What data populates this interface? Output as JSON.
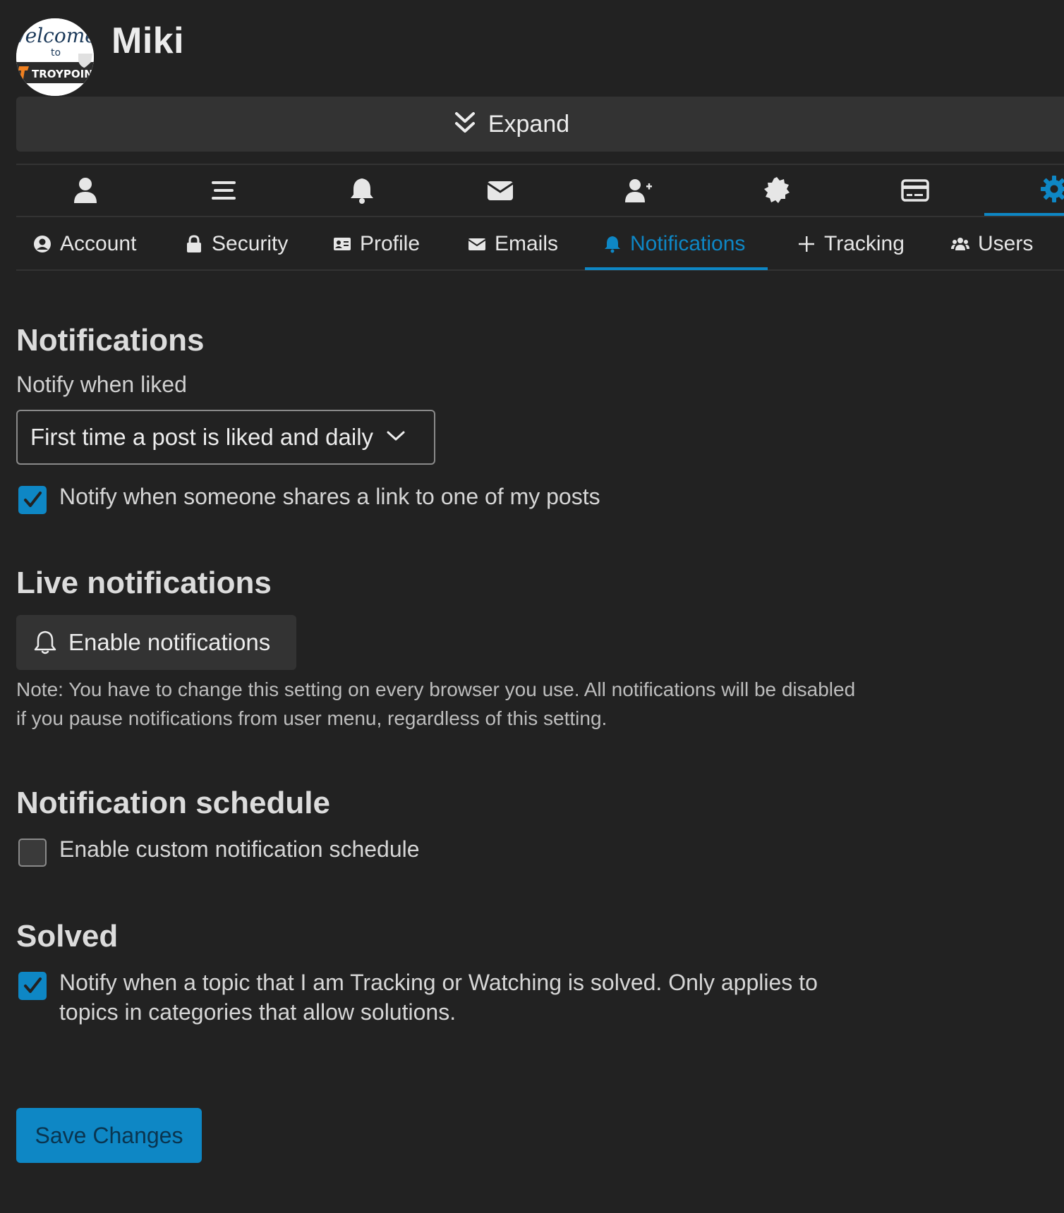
{
  "user": {
    "name": "Miki",
    "avatar_text": {
      "line1": "Welcome",
      "line2": "to",
      "line3": "TROYPOINT"
    }
  },
  "expand": {
    "label": "Expand",
    "icon": "double-chevron-down-icon"
  },
  "icon_nav": [
    {
      "name": "user-icon"
    },
    {
      "name": "activity-icon"
    },
    {
      "name": "bell-icon"
    },
    {
      "name": "envelope-icon"
    },
    {
      "name": "user-plus-icon"
    },
    {
      "name": "badge-icon"
    },
    {
      "name": "card-icon"
    },
    {
      "name": "gear-icon",
      "active": true
    }
  ],
  "tabs": [
    {
      "label": "Account",
      "icon": "user-circle-icon"
    },
    {
      "label": "Security",
      "icon": "lock-icon"
    },
    {
      "label": "Profile",
      "icon": "id-card-icon"
    },
    {
      "label": "Emails",
      "icon": "envelope-icon"
    },
    {
      "label": "Notifications",
      "icon": "bell-icon",
      "active": true
    },
    {
      "label": "Tracking",
      "icon": "plus-icon"
    },
    {
      "label": "Users",
      "icon": "users-icon"
    }
  ],
  "notifications": {
    "title": "Notifications",
    "liked_label": "Notify when liked",
    "liked_value": "First time a post is liked and daily",
    "share_link_label": "Notify when someone shares a link to one of my posts",
    "share_link_checked": true
  },
  "live": {
    "title": "Live notifications",
    "button_label": "Enable notifications",
    "note": "Note: You have to change this setting on every browser you use. All notifications will be disabled if you pause notifications from user menu, regardless of this setting."
  },
  "schedule": {
    "title": "Notification schedule",
    "label": "Enable custom notification schedule",
    "checked": false
  },
  "solved": {
    "title": "Solved",
    "label": "Notify when a topic that I am Tracking or Watching is solved. Only applies to topics in categories that allow solutions.",
    "checked": true
  },
  "save_label": "Save Changes",
  "colors": {
    "accent": "#0e87c5",
    "background": "#222222",
    "panel": "#333333"
  }
}
